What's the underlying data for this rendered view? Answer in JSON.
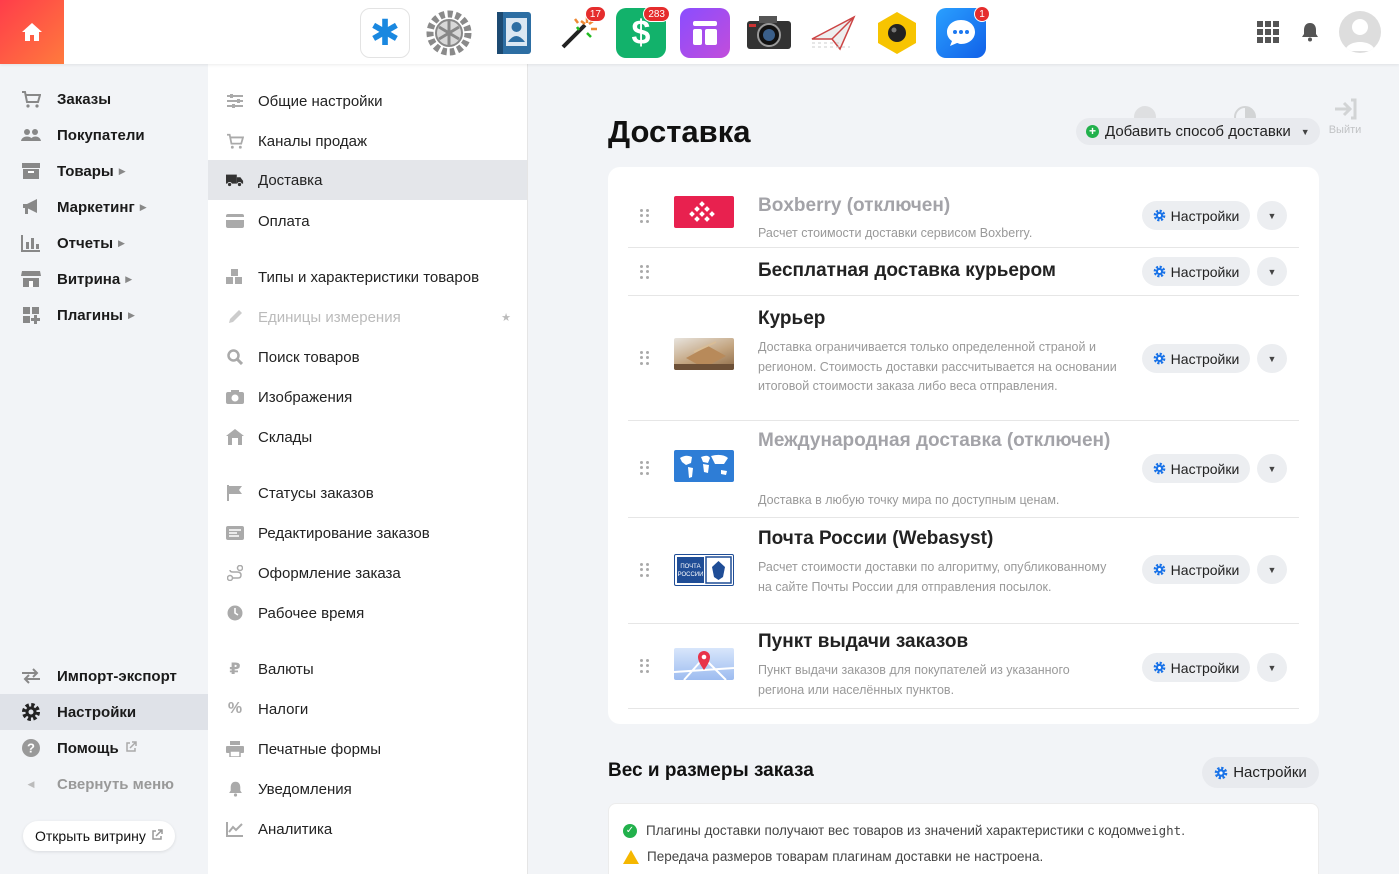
{
  "top_apps": [
    {
      "name": "asterisk-app-icon",
      "badge": ""
    },
    {
      "name": "gear-app-icon",
      "badge": ""
    },
    {
      "name": "contacts-app-icon",
      "badge": ""
    },
    {
      "name": "magic-wand-app-icon",
      "badge": "17"
    },
    {
      "name": "dollar-app-icon",
      "badge": "283"
    },
    {
      "name": "layout-app-icon",
      "badge": ""
    },
    {
      "name": "camera-app-icon",
      "badge": ""
    },
    {
      "name": "paper-plane-app-icon",
      "badge": ""
    },
    {
      "name": "hex-bug-app-icon",
      "badge": ""
    },
    {
      "name": "chat-app-icon",
      "badge": "1"
    }
  ],
  "sidebar": {
    "items": [
      {
        "label": "Заказы"
      },
      {
        "label": "Покупатели"
      },
      {
        "label": "Товары"
      },
      {
        "label": "Маркетинг"
      },
      {
        "label": "Отчеты"
      },
      {
        "label": "Витрина"
      },
      {
        "label": "Плагины"
      }
    ],
    "import_export": "Импорт-экспорт",
    "settings": "Настройки",
    "help": "Помощь",
    "collapse": "Свернуть меню",
    "open_store": "Открыть витрину"
  },
  "settings_menu": [
    {
      "label": "Общие настройки"
    },
    {
      "label": "Каналы продаж"
    },
    {
      "label": "Доставка"
    },
    {
      "label": "Оплата"
    },
    {
      "label": "Типы и характеристики товаров"
    },
    {
      "label": "Единицы измерения"
    },
    {
      "label": "Поиск товаров"
    },
    {
      "label": "Изображения"
    },
    {
      "label": "Склады"
    },
    {
      "label": "Статусы заказов"
    },
    {
      "label": "Редактирование заказов"
    },
    {
      "label": "Оформление заказа"
    },
    {
      "label": "Рабочее время"
    },
    {
      "label": "Валюты"
    },
    {
      "label": "Налоги"
    },
    {
      "label": "Печатные формы"
    },
    {
      "label": "Уведомления"
    },
    {
      "label": "Аналитика"
    }
  ],
  "ghost": {
    "logout": "Выйти"
  },
  "page": {
    "title": "Доставка",
    "add_button": "Добавить способ доставки",
    "settings_label": "Настройки"
  },
  "shipping": [
    {
      "title": "Boxberry (отключен)",
      "desc": "Расчет стоимости доставки сервисом Boxberry.",
      "disabled": true
    },
    {
      "title": "Бесплатная доставка курьером",
      "desc": "",
      "disabled": false
    },
    {
      "title": "Курьер",
      "desc": "Доставка ограничивается только определенной страной и регионом. Стоимость доставки рассчитывается на основании итоговой стоимости заказа либо веса отправления.",
      "disabled": false
    },
    {
      "title": "Международная доставка (отключен)",
      "desc": "Доставка в любую точку мира по доступным ценам.",
      "disabled": true
    },
    {
      "title": "Почта России (Webasyst)",
      "desc": "Расчет стоимости доставки по алгоритму, опубликованному на сайте Почты России для отправления посылок.",
      "disabled": false
    },
    {
      "title": "Пункт выдачи заказов",
      "desc": "Пункт выдачи заказов для покупателей из указанного региона или населённых пунктов.",
      "disabled": false
    }
  ],
  "weight_section": {
    "title": "Вес и размеры заказа",
    "button": "Настройки",
    "line1_a": "Плагины доставки получают вес товаров из значений характеристики с кодом ",
    "line1_code": "weight",
    "line1_b": ".",
    "line2": "Передача размеров товарам плагинам доставки не настроена."
  },
  "colors": {
    "accent": "#1a73e8",
    "home_gradient_start": "#ff3d4a",
    "home_gradient_end": "#ff7a3d",
    "ok": "#22b14c",
    "warn": "#f5b700"
  }
}
